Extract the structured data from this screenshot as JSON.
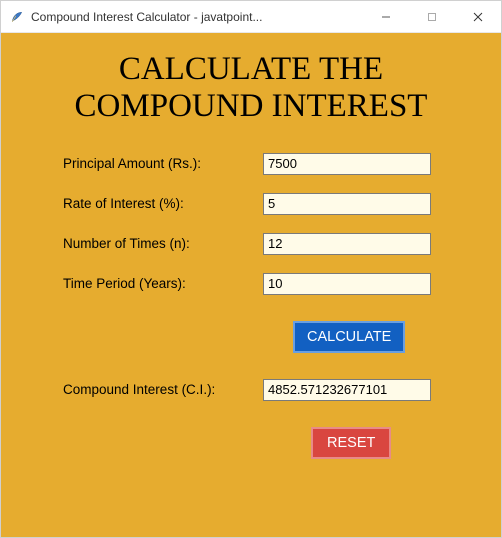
{
  "window": {
    "title": "Compound Interest Calculator - javatpoint..."
  },
  "heading": {
    "line1": "CALCULATE THE",
    "line2": "COMPOUND INTEREST"
  },
  "fields": {
    "principal": {
      "label": "Principal Amount (Rs.):",
      "value": "7500"
    },
    "rate": {
      "label": "Rate of Interest (%):",
      "value": "5"
    },
    "times": {
      "label": "Number of Times (n):",
      "value": "12"
    },
    "period": {
      "label": "Time Period (Years):",
      "value": "10"
    },
    "result": {
      "label": "Compound Interest (C.I.):",
      "value": "4852.571232677101"
    }
  },
  "buttons": {
    "calculate": "CALCULATE",
    "reset": "RESET"
  }
}
